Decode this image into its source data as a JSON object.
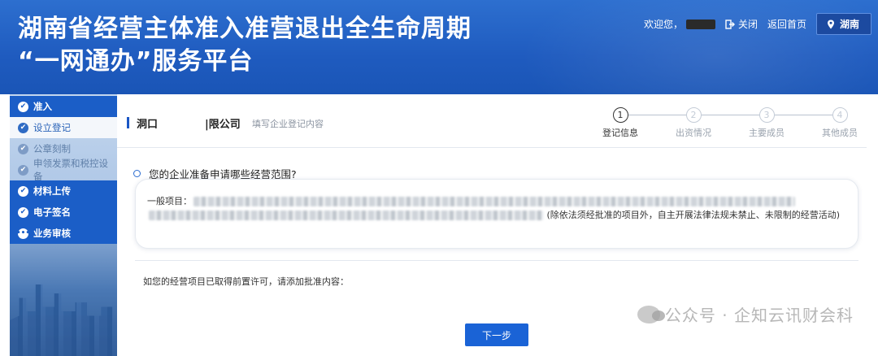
{
  "header": {
    "title_line1": "湖南省经营主体准入准营退出全生命周期",
    "title_line2": "“一网通办”服务平台",
    "welcome": "欢迎您，",
    "close_label": "关闭",
    "home_label": "返回首页",
    "region_label": "湖南"
  },
  "sidebar": {
    "items": [
      {
        "label": "准入",
        "type": "main"
      },
      {
        "label": "设立登记",
        "type": "sub-active"
      },
      {
        "label": "公章刻制",
        "type": "sub-muted"
      },
      {
        "label": "申领发票和税控设备",
        "type": "sub-muted"
      },
      {
        "label": "材料上传",
        "type": "main"
      },
      {
        "label": "电子签名",
        "type": "main"
      },
      {
        "label": "业务审核",
        "type": "main"
      }
    ]
  },
  "main": {
    "company_part1": "洞口",
    "company_part2": "|限公司",
    "hint": "填写企业登记内容",
    "steps": [
      {
        "num": "1",
        "label": "登记信息",
        "active": true
      },
      {
        "num": "2",
        "label": "出资情况",
        "active": false
      },
      {
        "num": "3",
        "label": "主要成员",
        "active": false
      },
      {
        "num": "4",
        "label": "其他成员",
        "active": false
      }
    ],
    "question": "您的企业准备申请哪些经营范围?",
    "scope_label": "一般项目：",
    "scope_note": "(除依法须经批准的项目外，自主开展法律法规未禁止、未限制的经营活动)",
    "permit_label": "如您的经营项目已取得前置许可，请添加批准内容：",
    "next_button": "下一步"
  },
  "watermark": {
    "text": "公众号 · 企知云讯财会科"
  },
  "colors": {
    "header_blue": "#1f5bbf",
    "sidebar_main": "#1b5ec7",
    "accent": "#1a63d6"
  }
}
